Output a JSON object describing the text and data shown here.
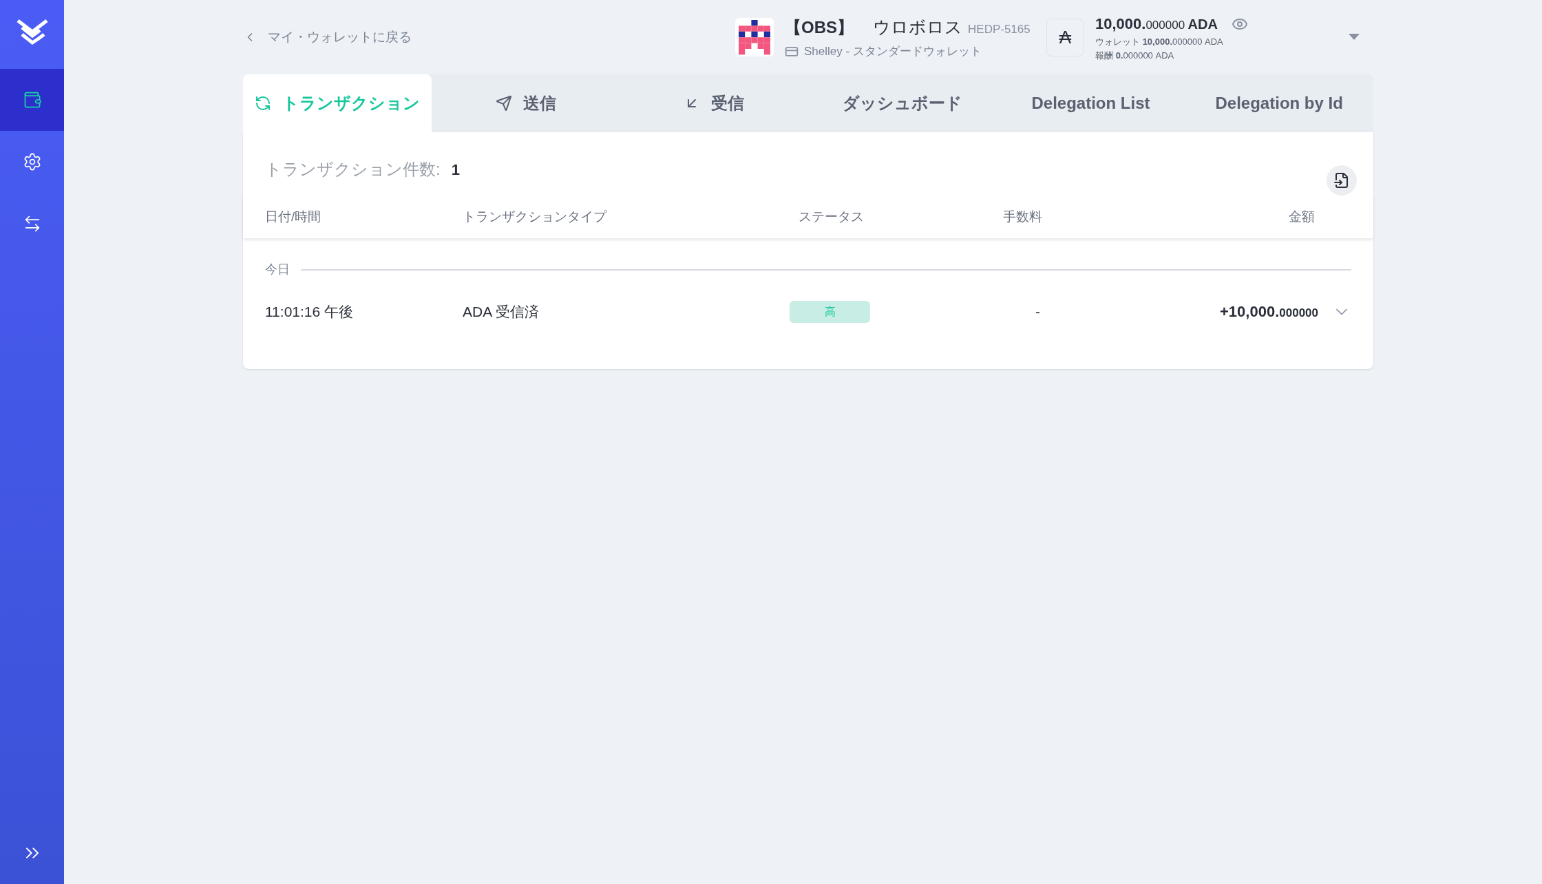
{
  "sidebar": {
    "items": [
      {
        "kind": "wallet",
        "selected": true
      },
      {
        "kind": "settings",
        "selected": false
      },
      {
        "kind": "transfer",
        "selected": false
      }
    ]
  },
  "back_link": "マイ・ウォレットに戻る",
  "wallet": {
    "ticker": "【OBS】",
    "name": "ウロボロス",
    "plate": "HEDP-5165",
    "type": "Shelley - スタンダードウォレット"
  },
  "balance": {
    "total_int": "10,000.",
    "total_dec": "000000",
    "unit": "ADA",
    "wallet_label": "ウォレット",
    "wallet_int": "10,000.",
    "wallet_dec": "000000",
    "wallet_unit": "ADA",
    "reward_label": "報酬",
    "reward_int": "0.",
    "reward_dec": "000000",
    "reward_unit": "ADA"
  },
  "ada_symbol": "₳",
  "tabs": [
    {
      "label": "トランザクション",
      "kind": "tx",
      "selected": true
    },
    {
      "label": "送信",
      "kind": "send",
      "selected": false
    },
    {
      "label": "受信",
      "kind": "receive",
      "selected": false
    },
    {
      "label": "ダッシュボード",
      "selected": false
    },
    {
      "label": "Delegation List",
      "selected": false
    },
    {
      "label": "Delegation by Id",
      "selected": false
    }
  ],
  "count_label": "トランザクション件数:",
  "count": "1",
  "table": {
    "columns": [
      "日付/時間",
      "トランザクションタイプ",
      "ステータス",
      "手数料",
      "金額"
    ],
    "groups": [
      {
        "label": "今日",
        "rows": [
          {
            "time": "11:01:16 午後",
            "type": "ADA 受信済",
            "status": "高",
            "fee": "-",
            "amount_int": "+10,000.",
            "amount_dec": "000000",
            "expanded": false
          }
        ]
      }
    ]
  }
}
